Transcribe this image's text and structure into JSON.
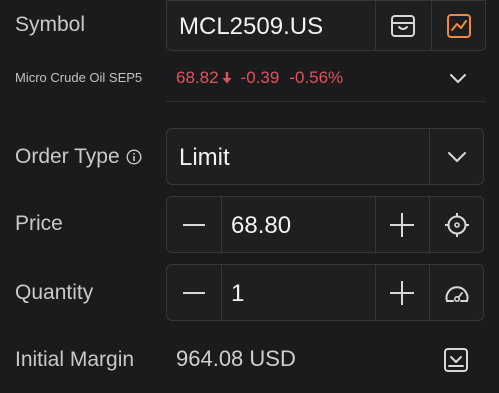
{
  "symbol": {
    "label": "Symbol",
    "value": "MCL2509.US",
    "icons": [
      "inbox-icon",
      "chart-icon"
    ],
    "accent": "#f0883e"
  },
  "quote": {
    "name": "Micro Crude Oil SEP5",
    "price": "68.82",
    "change": "-0.39",
    "change_pct": "-0.56%",
    "down_color": "#e0525c"
  },
  "order_type": {
    "label": "Order Type",
    "value": "Limit"
  },
  "price": {
    "label": "Price",
    "value": "68.80"
  },
  "quantity": {
    "label": "Quantity",
    "value": "1"
  },
  "margin": {
    "label": "Initial Margin",
    "value": "964.08 USD"
  }
}
